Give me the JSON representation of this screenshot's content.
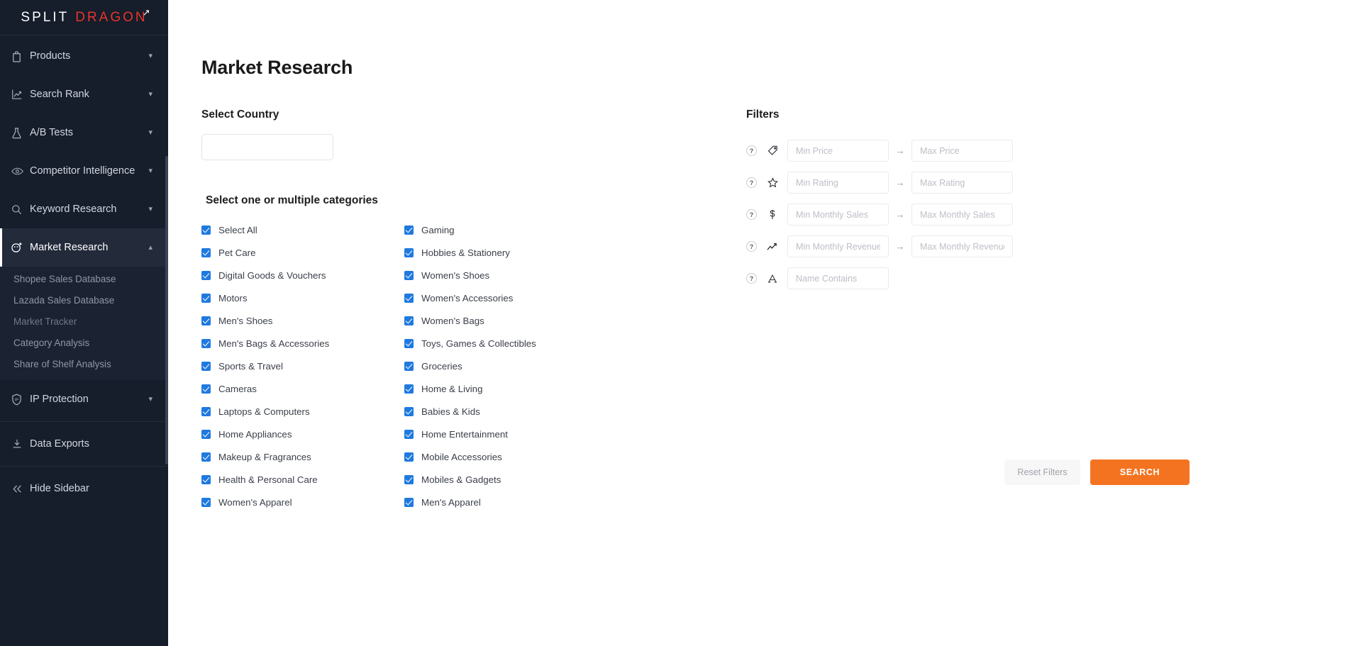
{
  "brand": {
    "name_left": "SPLIT",
    "name_right": "DRAGON"
  },
  "sidebar": {
    "items": [
      {
        "label": "Products",
        "icon": "bag-icon",
        "chevron": "⌄"
      },
      {
        "label": "Search Rank",
        "icon": "trend-up-icon",
        "chevron": "⌄"
      },
      {
        "label": "A/B Tests",
        "icon": "flask-icon",
        "chevron": "⌄"
      },
      {
        "label": "Competitor Intelligence",
        "icon": "eye-icon",
        "chevron": "⌄"
      },
      {
        "label": "Keyword Research",
        "icon": "search-icon",
        "chevron": "⌄"
      },
      {
        "label": "Market Research",
        "icon": "market-research-icon",
        "chevron": "⌃"
      },
      {
        "label": "IP Protection",
        "icon": "shield-ip-icon",
        "chevron": "⌄"
      }
    ],
    "market_research_subitems": [
      "Shopee Sales Database",
      "Lazada Sales Database",
      "Market Tracker",
      "Category Analysis",
      "Share of Shelf Analysis"
    ],
    "data_exports": "Data Exports",
    "hide_sidebar": "Hide Sidebar"
  },
  "header": {
    "title": "Market Research"
  },
  "country": {
    "label": "Select Country",
    "value": "",
    "placeholder": ""
  },
  "categories": {
    "title": "Select one or multiple categories",
    "column_left": [
      "Select All",
      "Pet Care",
      "Digital Goods & Vouchers",
      "Motors",
      "Men's Shoes",
      "Men's Bags & Accessories",
      "Sports & Travel",
      "Cameras",
      "Laptops & Computers",
      "Home Appliances",
      "Makeup & Fragrances",
      "Health & Personal Care",
      "Women's Apparel"
    ],
    "column_right": [
      "Gaming",
      "Hobbies & Stationery",
      "Women's Shoes",
      "Women's Accessories",
      "Women's Bags",
      "Toys, Games & Collectibles",
      "Groceries",
      "Home & Living",
      "Babies & Kids",
      "Home Entertainment",
      "Mobile Accessories",
      "Mobiles & Gadgets",
      "Men's Apparel"
    ]
  },
  "filters": {
    "title": "Filters",
    "arrow": "→",
    "help_glyph": "?",
    "rows": [
      {
        "icon": "price-tag-icon",
        "min_placeholder": "Min Price",
        "max_placeholder": "Max Price",
        "min_value": "",
        "max_value": ""
      },
      {
        "icon": "star-icon",
        "min_placeholder": "Min Rating",
        "max_placeholder": "Max Rating",
        "min_value": "",
        "max_value": ""
      },
      {
        "icon": "dollar-coin-icon",
        "min_placeholder": "Min Monthly Sales",
        "max_placeholder": "Max Monthly Sales",
        "min_value": "",
        "max_value": ""
      },
      {
        "icon": "revenue-chart-icon",
        "min_placeholder": "Min Monthly Revenue",
        "max_placeholder": "Max Monthly Revenue",
        "min_value": "",
        "max_value": ""
      }
    ],
    "name_row": {
      "icon": "letter-a-icon",
      "placeholder": "Name Contains",
      "value": ""
    }
  },
  "actions": {
    "reset_label": "Reset Filters",
    "search_label": "SEARCH"
  },
  "colors": {
    "accent": "#f47321",
    "brand_red": "#e8342a",
    "checkbox_blue": "#1f7ae0",
    "sidebar_bg": "#161d2b"
  }
}
